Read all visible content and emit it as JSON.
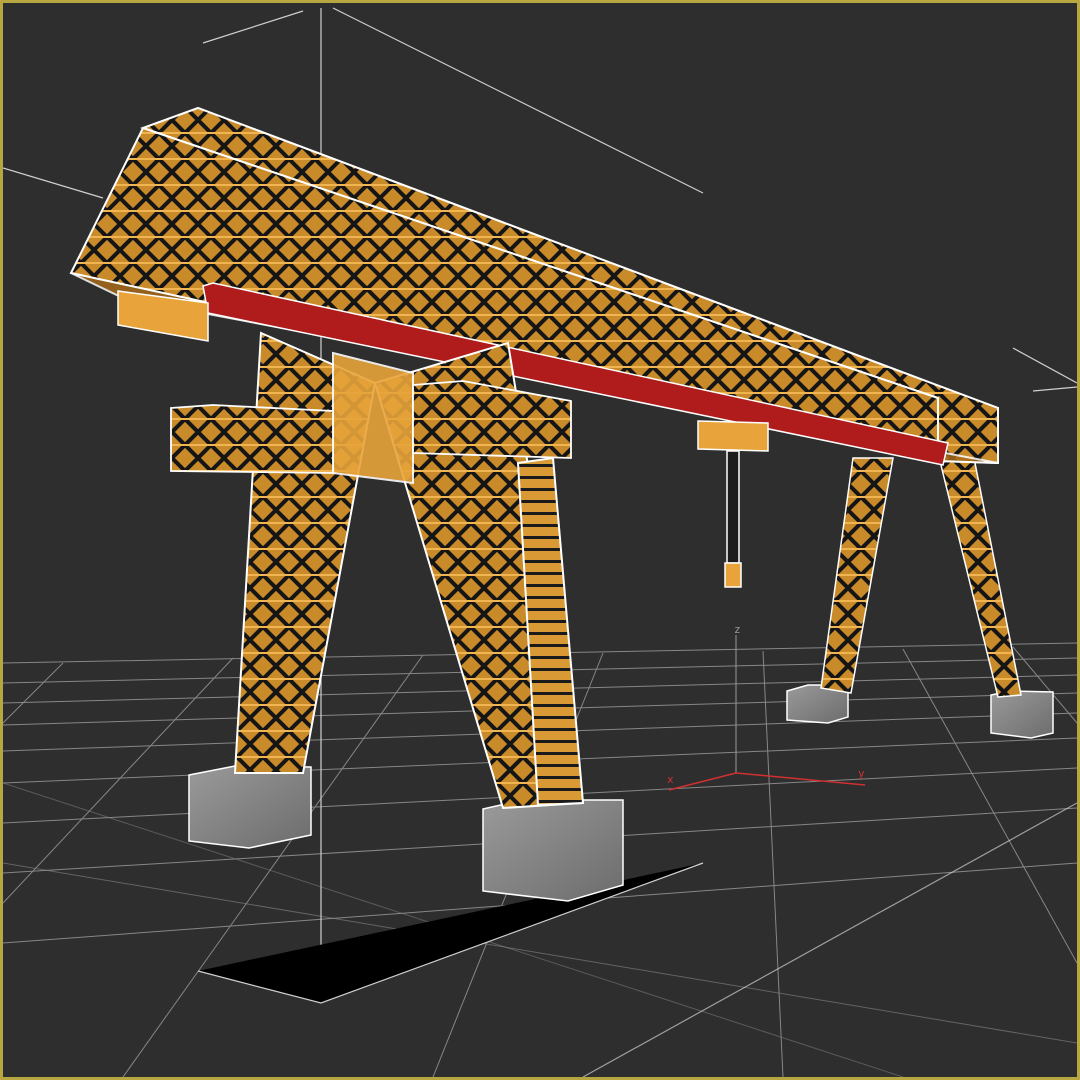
{
  "viewport": {
    "border_color": "#b8a640",
    "background_color": "#2e2e2e",
    "grid_color": "#bdbdbd"
  },
  "gizmo": {
    "x_label": "x",
    "y_label": "y",
    "z_label": "z",
    "x_color": "#d23030",
    "y_color": "#d23030",
    "z_color": "#9a9a9a"
  },
  "model": {
    "frame_color": "#e8a43a",
    "frame_dark": "#b2731c",
    "rail_color": "#b01c1c",
    "footing_color": "#8f8f8f",
    "outline_color": "#ffffff"
  }
}
